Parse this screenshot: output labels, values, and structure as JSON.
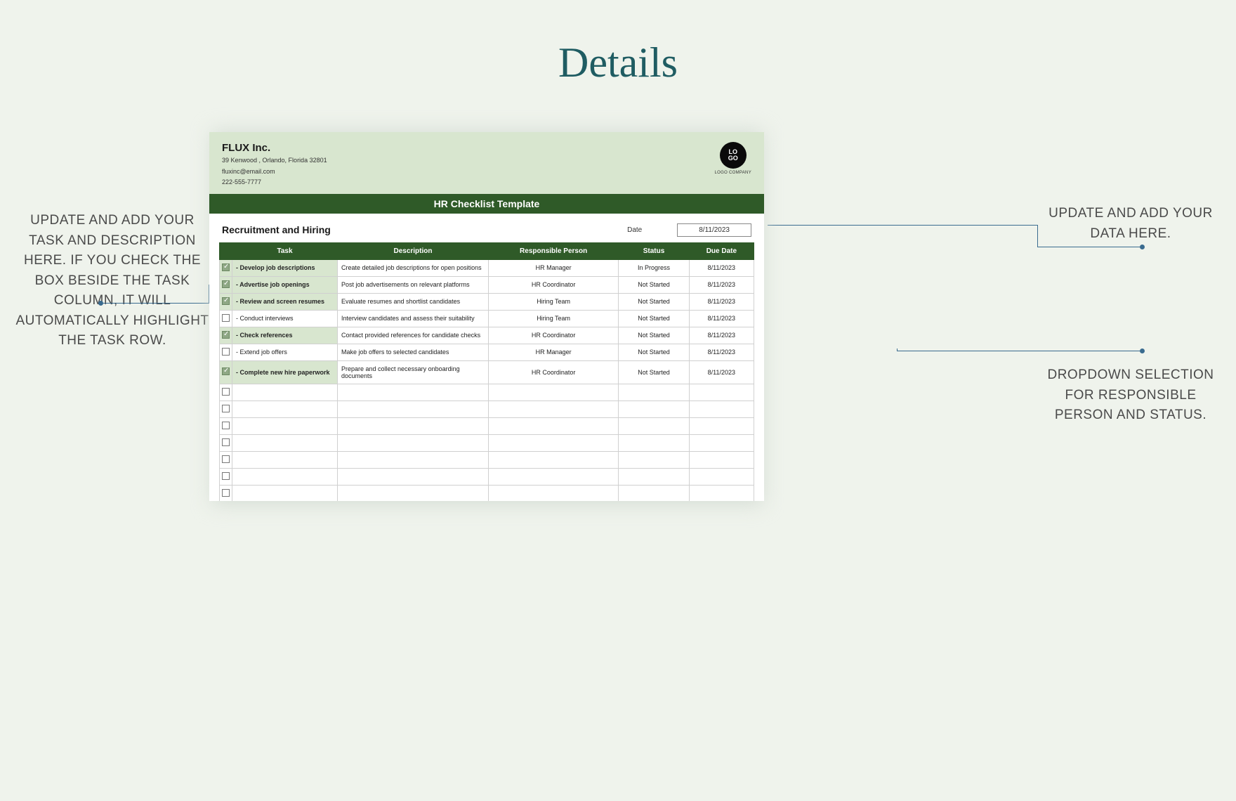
{
  "pageTitle": "Details",
  "callouts": {
    "left": "UPDATE AND ADD YOUR TASK AND DESCRIPTION HERE. IF YOU CHECK THE BOX BESIDE THE TASK COLUMN, IT WILL AUTOMATICALLY HIGHLIGHT THE TASK ROW.",
    "rightTop": "UPDATE AND ADD YOUR DATA HERE.",
    "rightBottom": "DROPDOWN SELECTION FOR RESPONSIBLE PERSON AND STATUS."
  },
  "company": {
    "name": "FLUX Inc.",
    "address": "39 Kenwood , Orlando, Florida 32801",
    "email": "fluxinc@email.com",
    "phone": "222-555-7777"
  },
  "logo": {
    "text": "LO\nGO",
    "sub": "LOGO COMPANY"
  },
  "titleBar": "HR Checklist Template",
  "section": "Recruitment and Hiring",
  "dateLabel": "Date",
  "dateValue": "8/11/2023",
  "columns": {
    "c0": "",
    "c1": "Task",
    "c2": "Description",
    "c3": "Responsible Person",
    "c4": "Status",
    "c5": "Due Date"
  },
  "rows": [
    {
      "checked": true,
      "task": "- Develop job descriptions",
      "desc": "Create detailed job descriptions for open positions",
      "resp": "HR Manager",
      "status": "In Progress",
      "due": "8/11/2023"
    },
    {
      "checked": true,
      "task": "- Advertise job openings",
      "desc": "Post job advertisements on relevant platforms",
      "resp": "HR Coordinator",
      "status": "Not Started",
      "due": "8/11/2023"
    },
    {
      "checked": true,
      "task": "- Review and screen resumes",
      "desc": "Evaluate resumes and shortlist candidates",
      "resp": "Hiring Team",
      "status": "Not Started",
      "due": "8/11/2023"
    },
    {
      "checked": false,
      "task": "- Conduct interviews",
      "desc": "Interview candidates and assess their suitability",
      "resp": "Hiring Team",
      "status": "Not Started",
      "due": "8/11/2023"
    },
    {
      "checked": true,
      "task": "- Check references",
      "desc": "Contact provided references for candidate checks",
      "resp": "HR Coordinator",
      "status": "Not Started",
      "due": "8/11/2023"
    },
    {
      "checked": false,
      "task": "- Extend job offers",
      "desc": "Make job offers to selected candidates",
      "resp": "HR Manager",
      "status": "Not Started",
      "due": "8/11/2023"
    },
    {
      "checked": true,
      "task": "- Complete new hire paperwork",
      "desc": "Prepare and collect necessary onboarding documents",
      "resp": "HR Coordinator",
      "status": "Not Started",
      "due": "8/11/2023"
    },
    {
      "checked": false,
      "task": "",
      "desc": "",
      "resp": "",
      "status": "",
      "due": ""
    },
    {
      "checked": false,
      "task": "",
      "desc": "",
      "resp": "",
      "status": "",
      "due": ""
    },
    {
      "checked": false,
      "task": "",
      "desc": "",
      "resp": "",
      "status": "",
      "due": ""
    },
    {
      "checked": false,
      "task": "",
      "desc": "",
      "resp": "",
      "status": "",
      "due": ""
    },
    {
      "checked": false,
      "task": "",
      "desc": "",
      "resp": "",
      "status": "",
      "due": ""
    },
    {
      "checked": false,
      "task": "",
      "desc": "",
      "resp": "",
      "status": "",
      "due": ""
    },
    {
      "checked": false,
      "task": "",
      "desc": "",
      "resp": "",
      "status": "",
      "due": ""
    }
  ]
}
